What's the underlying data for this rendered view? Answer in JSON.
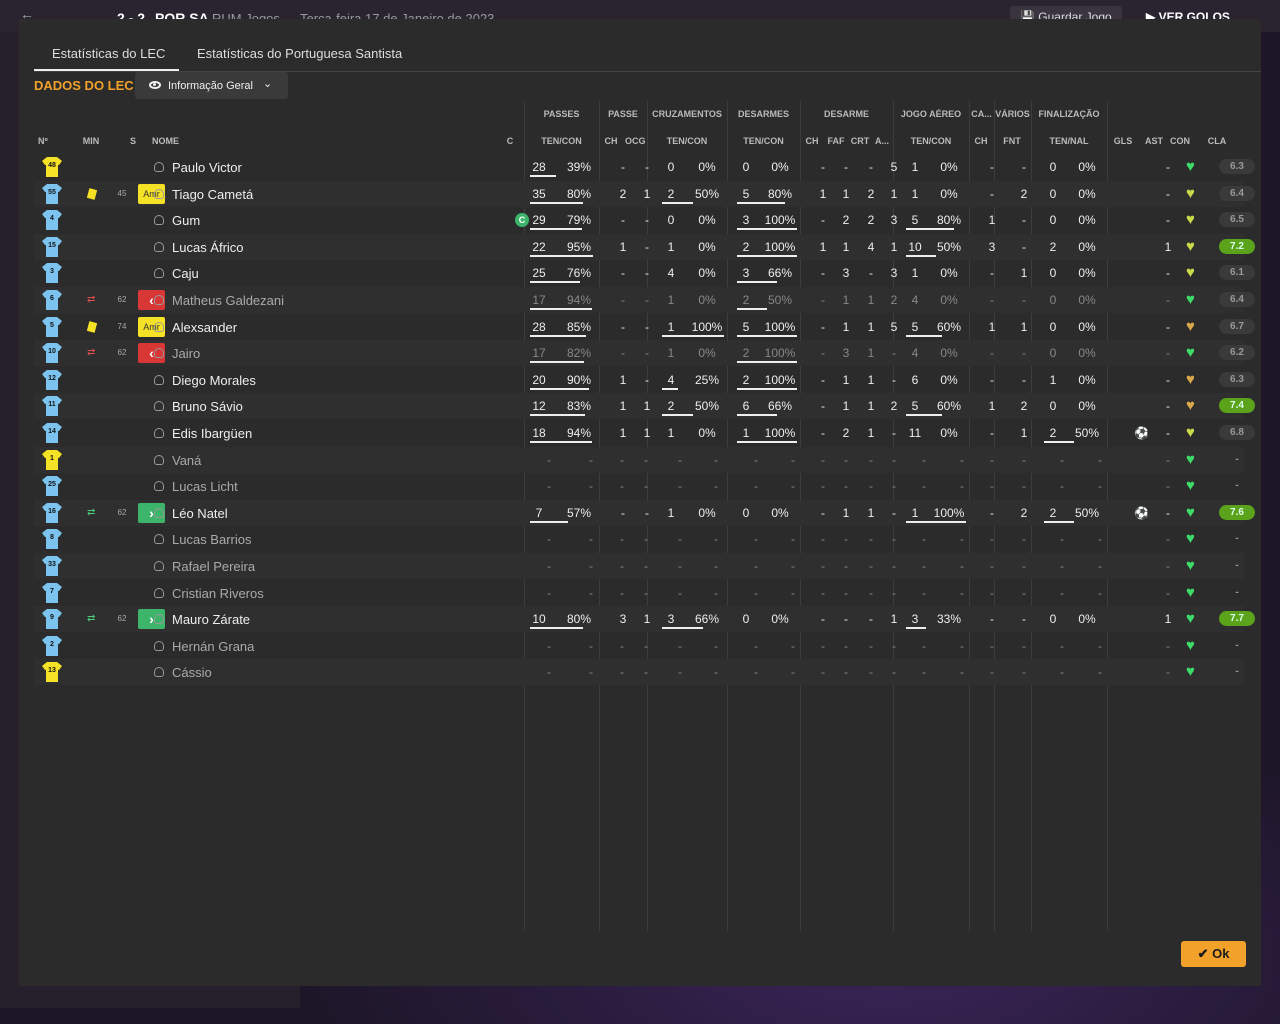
{
  "topbar": {
    "score": "2 - 2",
    "opponent": "POR SA",
    "mode": "RUM Jogos",
    "date": "Terça-feira 17 de Janeiro de 2023",
    "save_label": "Guardar Jogo",
    "goals_label": "VER GOLOS"
  },
  "tabs": {
    "lec": "Estatísticas do LEC",
    "opp": "Estatísticas do Portuguesa Santista"
  },
  "section_title": "DADOS DO LEC",
  "view_dropdown": "Informação Geral",
  "group_headers": {
    "passes": "PASSES",
    "passe": "PASSE",
    "cruzamentos": "CRUZAMENTOS",
    "desarmes": "DESARMES",
    "desarme": "DESARME",
    "jogo_aereo": "JOGO AÉREO",
    "ca": "CA...",
    "varios": "VÁRIOS",
    "finalizacao": "FINALIZAÇÃO"
  },
  "sub_headers": {
    "num": "Nº",
    "min": "MIN",
    "s": "S",
    "nome": "NOME",
    "c": "C",
    "passes": "TEN/CON",
    "ch1": "CH",
    "ocg": "OCG",
    "cruz": "TEN/CON",
    "des": "TEN/CON",
    "ch2": "CH",
    "faf": "FAF",
    "crt": "CRT",
    "a": "A...",
    "aereo": "TEN/CON",
    "ch3": "CH",
    "fnt": "FNT",
    "fin": "TEN/NAL",
    "gls": "GLS",
    "ast": "AST",
    "con": "CON",
    "cla": "CLA"
  },
  "players": [
    {
      "num": "48",
      "kit": "yellow",
      "min": "",
      "card": false,
      "sub": "",
      "badge": "",
      "name": "Paulo Victor",
      "captain": false,
      "active": true,
      "p": [
        "28",
        "39%"
      ],
      "pf": 0.39,
      "ch": "-",
      "ocg": "-",
      "cr": [
        "0",
        "0%"
      ],
      "crf": 0,
      "de": [
        "0",
        "0%"
      ],
      "def": 0,
      "ch2": "-",
      "faf": "-",
      "crt": "-",
      "a": "5",
      "ae": [
        "1",
        "0%"
      ],
      "aef": 0,
      "ch3": "-",
      "fnt": "-",
      "fi": [
        "0",
        "0%"
      ],
      "fif": 0,
      "gls": "",
      "ast": "-",
      "heart": "good",
      "cla": "6.3",
      "hi": false
    },
    {
      "num": "55",
      "kit": "blue",
      "min": "45",
      "card": true,
      "sub": "",
      "badge": "Amr",
      "name": "Tiago Cametá",
      "captain": false,
      "active": true,
      "p": [
        "35",
        "80%"
      ],
      "pf": 0.8,
      "ch": "2",
      "ocg": "1",
      "cr": [
        "2",
        "50%"
      ],
      "crf": 0.5,
      "de": [
        "5",
        "80%"
      ],
      "def": 0.8,
      "ch2": "1",
      "faf": "1",
      "crt": "2",
      "a": "1",
      "ae": [
        "1",
        "0%"
      ],
      "aef": 0,
      "ch3": "-",
      "fnt": "2",
      "fi": [
        "0",
        "0%"
      ],
      "fif": 0,
      "gls": "",
      "ast": "-",
      "heart": "ok",
      "cla": "6.4",
      "hi": false
    },
    {
      "num": "4",
      "kit": "blue",
      "min": "",
      "card": false,
      "sub": "",
      "badge": "",
      "name": "Gum",
      "captain": true,
      "active": true,
      "p": [
        "29",
        "79%"
      ],
      "pf": 0.79,
      "ch": "-",
      "ocg": "-",
      "cr": [
        "0",
        "0%"
      ],
      "crf": 0,
      "de": [
        "3",
        "100%"
      ],
      "def": 1,
      "ch2": "-",
      "faf": "2",
      "crt": "2",
      "a": "3",
      "ae": [
        "5",
        "80%"
      ],
      "aef": 0.8,
      "ch3": "1",
      "fnt": "-",
      "fi": [
        "0",
        "0%"
      ],
      "fif": 0,
      "gls": "",
      "ast": "-",
      "heart": "ok",
      "cla": "6.5",
      "hi": false
    },
    {
      "num": "15",
      "kit": "blue",
      "min": "",
      "card": false,
      "sub": "",
      "badge": "",
      "name": "Lucas Áfrico",
      "captain": false,
      "active": true,
      "p": [
        "22",
        "95%"
      ],
      "pf": 0.95,
      "ch": "1",
      "ocg": "-",
      "cr": [
        "1",
        "0%"
      ],
      "crf": 0,
      "de": [
        "2",
        "100%"
      ],
      "def": 1,
      "ch2": "1",
      "faf": "1",
      "crt": "4",
      "a": "1",
      "ae": [
        "10",
        "50%"
      ],
      "aef": 0.5,
      "ch3": "3",
      "fnt": "-",
      "fi": [
        "2",
        "0%"
      ],
      "fif": 0,
      "gls": "",
      "ast": "1",
      "heart": "ok",
      "cla": "7.2",
      "hi": true
    },
    {
      "num": "3",
      "kit": "blue",
      "min": "",
      "card": false,
      "sub": "",
      "badge": "",
      "name": "Caju",
      "captain": false,
      "active": true,
      "p": [
        "25",
        "76%"
      ],
      "pf": 0.76,
      "ch": "-",
      "ocg": "-",
      "cr": [
        "4",
        "0%"
      ],
      "crf": 0,
      "de": [
        "3",
        "66%"
      ],
      "def": 0.66,
      "ch2": "-",
      "faf": "3",
      "crt": "-",
      "a": "3",
      "ae": [
        "1",
        "0%"
      ],
      "aef": 0,
      "ch3": "-",
      "fnt": "1",
      "fi": [
        "0",
        "0%"
      ],
      "fif": 0,
      "gls": "",
      "ast": "-",
      "heart": "ok",
      "cla": "6.1",
      "hi": false
    },
    {
      "num": "6",
      "kit": "blue",
      "min": "62",
      "card": false,
      "sub": "out",
      "badge": "out",
      "name": "Matheus Galdezani",
      "captain": false,
      "active": false,
      "p": [
        "17",
        "94%"
      ],
      "pf": 0.94,
      "ch": "-",
      "ocg": "-",
      "cr": [
        "1",
        "0%"
      ],
      "crf": 0,
      "de": [
        "2",
        "50%"
      ],
      "def": 0.5,
      "ch2": "-",
      "faf": "1",
      "crt": "1",
      "a": "2",
      "ae": [
        "4",
        "0%"
      ],
      "aef": 0,
      "ch3": "-",
      "fnt": "-",
      "fi": [
        "0",
        "0%"
      ],
      "fif": 0,
      "gls": "",
      "ast": "-",
      "heart": "good",
      "cla": "6.4",
      "hi": false
    },
    {
      "num": "5",
      "kit": "blue",
      "min": "74",
      "card": true,
      "sub": "",
      "badge": "Amr",
      "name": "Alexsander",
      "captain": false,
      "active": true,
      "p": [
        "28",
        "85%"
      ],
      "pf": 0.85,
      "ch": "-",
      "ocg": "-",
      "cr": [
        "1",
        "100%"
      ],
      "crf": 1,
      "de": [
        "5",
        "100%"
      ],
      "def": 1,
      "ch2": "-",
      "faf": "1",
      "crt": "1",
      "a": "5",
      "ae": [
        "5",
        "60%"
      ],
      "aef": 0.6,
      "ch3": "1",
      "fnt": "1",
      "fi": [
        "0",
        "0%"
      ],
      "fif": 0,
      "gls": "",
      "ast": "-",
      "heart": "warn",
      "cla": "6.7",
      "hi": false
    },
    {
      "num": "10",
      "kit": "blue",
      "min": "62",
      "card": false,
      "sub": "out",
      "badge": "out",
      "name": "Jairo",
      "captain": false,
      "active": false,
      "p": [
        "17",
        "82%"
      ],
      "pf": 0.82,
      "ch": "-",
      "ocg": "-",
      "cr": [
        "1",
        "0%"
      ],
      "crf": 0,
      "de": [
        "2",
        "100%"
      ],
      "def": 1,
      "ch2": "-",
      "faf": "3",
      "crt": "1",
      "a": "-",
      "ae": [
        "4",
        "0%"
      ],
      "aef": 0,
      "ch3": "-",
      "fnt": "-",
      "fi": [
        "0",
        "0%"
      ],
      "fif": 0,
      "gls": "",
      "ast": "-",
      "heart": "good",
      "cla": "6.2",
      "hi": false
    },
    {
      "num": "12",
      "kit": "blue",
      "min": "",
      "card": false,
      "sub": "",
      "badge": "",
      "name": "Diego Morales",
      "captain": false,
      "active": true,
      "p": [
        "20",
        "90%"
      ],
      "pf": 0.9,
      "ch": "1",
      "ocg": "-",
      "cr": [
        "4",
        "25%"
      ],
      "crf": 0.25,
      "de": [
        "2",
        "100%"
      ],
      "def": 1,
      "ch2": "-",
      "faf": "1",
      "crt": "1",
      "a": "-",
      "ae": [
        "6",
        "0%"
      ],
      "aef": 0,
      "ch3": "-",
      "fnt": "-",
      "fi": [
        "1",
        "0%"
      ],
      "fif": 0,
      "gls": "",
      "ast": "-",
      "heart": "warn",
      "cla": "6.3",
      "hi": false
    },
    {
      "num": "11",
      "kit": "blue",
      "min": "",
      "card": false,
      "sub": "",
      "badge": "",
      "name": "Bruno Sávio",
      "captain": false,
      "active": true,
      "p": [
        "12",
        "83%"
      ],
      "pf": 0.83,
      "ch": "1",
      "ocg": "1",
      "cr": [
        "2",
        "50%"
      ],
      "crf": 0.5,
      "de": [
        "6",
        "66%"
      ],
      "def": 0.66,
      "ch2": "-",
      "faf": "1",
      "crt": "1",
      "a": "2",
      "ae": [
        "5",
        "60%"
      ],
      "aef": 0.6,
      "ch3": "1",
      "fnt": "2",
      "fi": [
        "0",
        "0%"
      ],
      "fif": 0,
      "gls": "",
      "ast": "-",
      "heart": "warn",
      "cla": "7.4",
      "hi": true
    },
    {
      "num": "14",
      "kit": "blue",
      "min": "",
      "card": false,
      "sub": "",
      "badge": "",
      "name": "Edis Ibargüen",
      "captain": false,
      "active": true,
      "p": [
        "18",
        "94%"
      ],
      "pf": 0.94,
      "ch": "1",
      "ocg": "1",
      "cr": [
        "1",
        "0%"
      ],
      "crf": 0,
      "de": [
        "1",
        "100%"
      ],
      "def": 1,
      "ch2": "-",
      "faf": "2",
      "crt": "1",
      "a": "-",
      "ae": [
        "11",
        "0%"
      ],
      "aef": 0,
      "ch3": "-",
      "fnt": "1",
      "fi": [
        "2",
        "50%"
      ],
      "fif": 0.5,
      "gls": "ball",
      "ast": "-",
      "heart": "ok",
      "cla": "6.8",
      "hi": false
    },
    {
      "num": "1",
      "kit": "yellow",
      "min": "",
      "card": false,
      "sub": "",
      "badge": "",
      "name": "Vaná",
      "captain": false,
      "active": false,
      "empty": true,
      "heart": "good",
      "cla": "-",
      "hi": false
    },
    {
      "num": "25",
      "kit": "blue",
      "min": "",
      "card": false,
      "sub": "",
      "badge": "",
      "name": "Lucas Licht",
      "captain": false,
      "active": false,
      "empty": true,
      "heart": "good",
      "cla": "-",
      "hi": false
    },
    {
      "num": "16",
      "kit": "blue",
      "min": "62",
      "card": false,
      "sub": "in",
      "badge": "in",
      "name": "Léo Natel",
      "captain": false,
      "active": true,
      "p": [
        "7",
        "57%"
      ],
      "pf": 0.57,
      "ch": "-",
      "ocg": "-",
      "cr": [
        "1",
        "0%"
      ],
      "crf": 0,
      "de": [
        "0",
        "0%"
      ],
      "def": 0,
      "ch2": "-",
      "faf": "1",
      "crt": "1",
      "a": "-",
      "ae": [
        "1",
        "100%"
      ],
      "aef": 1,
      "ch3": "-",
      "fnt": "2",
      "fi": [
        "2",
        "50%"
      ],
      "fif": 0.5,
      "gls": "ball",
      "ast": "-",
      "heart": "good",
      "cla": "7.6",
      "hi": true
    },
    {
      "num": "8",
      "kit": "blue",
      "min": "",
      "card": false,
      "sub": "",
      "badge": "",
      "name": "Lucas Barrios",
      "captain": false,
      "active": false,
      "empty": true,
      "heart": "good",
      "cla": "-",
      "hi": false
    },
    {
      "num": "33",
      "kit": "blue",
      "min": "",
      "card": false,
      "sub": "",
      "badge": "",
      "name": "Rafael Pereira",
      "captain": false,
      "active": false,
      "empty": true,
      "heart": "good",
      "cla": "-",
      "hi": false
    },
    {
      "num": "7",
      "kit": "blue",
      "min": "",
      "card": false,
      "sub": "",
      "badge": "",
      "name": "Cristian Riveros",
      "captain": false,
      "active": false,
      "empty": true,
      "heart": "good",
      "cla": "-",
      "hi": false
    },
    {
      "num": "9",
      "kit": "blue",
      "min": "62",
      "card": false,
      "sub": "in",
      "badge": "in",
      "name": "Mauro Zárate",
      "captain": false,
      "active": true,
      "p": [
        "10",
        "80%"
      ],
      "pf": 0.8,
      "ch": "3",
      "ocg": "1",
      "cr": [
        "3",
        "66%"
      ],
      "crf": 0.66,
      "de": [
        "0",
        "0%"
      ],
      "def": 0,
      "ch2": "-",
      "faf": "-",
      "crt": "-",
      "a": "1",
      "ae": [
        "3",
        "33%"
      ],
      "aef": 0.33,
      "ch3": "-",
      "fnt": "-",
      "fi": [
        "0",
        "0%"
      ],
      "fif": 0,
      "gls": "",
      "ast": "1",
      "heart": "good",
      "cla": "7.7",
      "hi": true
    },
    {
      "num": "2",
      "kit": "blue",
      "min": "",
      "card": false,
      "sub": "",
      "badge": "",
      "name": "Hernán Grana",
      "captain": false,
      "active": false,
      "empty": true,
      "heart": "good",
      "cla": "-",
      "hi": false
    },
    {
      "num": "13",
      "kit": "yellow",
      "min": "",
      "card": false,
      "sub": "",
      "badge": "",
      "name": "Cássio",
      "captain": false,
      "active": false,
      "empty": true,
      "heart": "good",
      "cla": "-",
      "hi": false
    }
  ],
  "badges": {
    "amr": "Amr",
    "out": "‹",
    "in": "›",
    "captain": "C"
  },
  "ok_label": "Ok",
  "colors": {
    "accent": "#f2a12a",
    "rating_high": "#5ba31b",
    "heart_good": "#3ddc6a",
    "heart_ok": "#c9d94a",
    "heart_warn": "#d9a84a"
  }
}
